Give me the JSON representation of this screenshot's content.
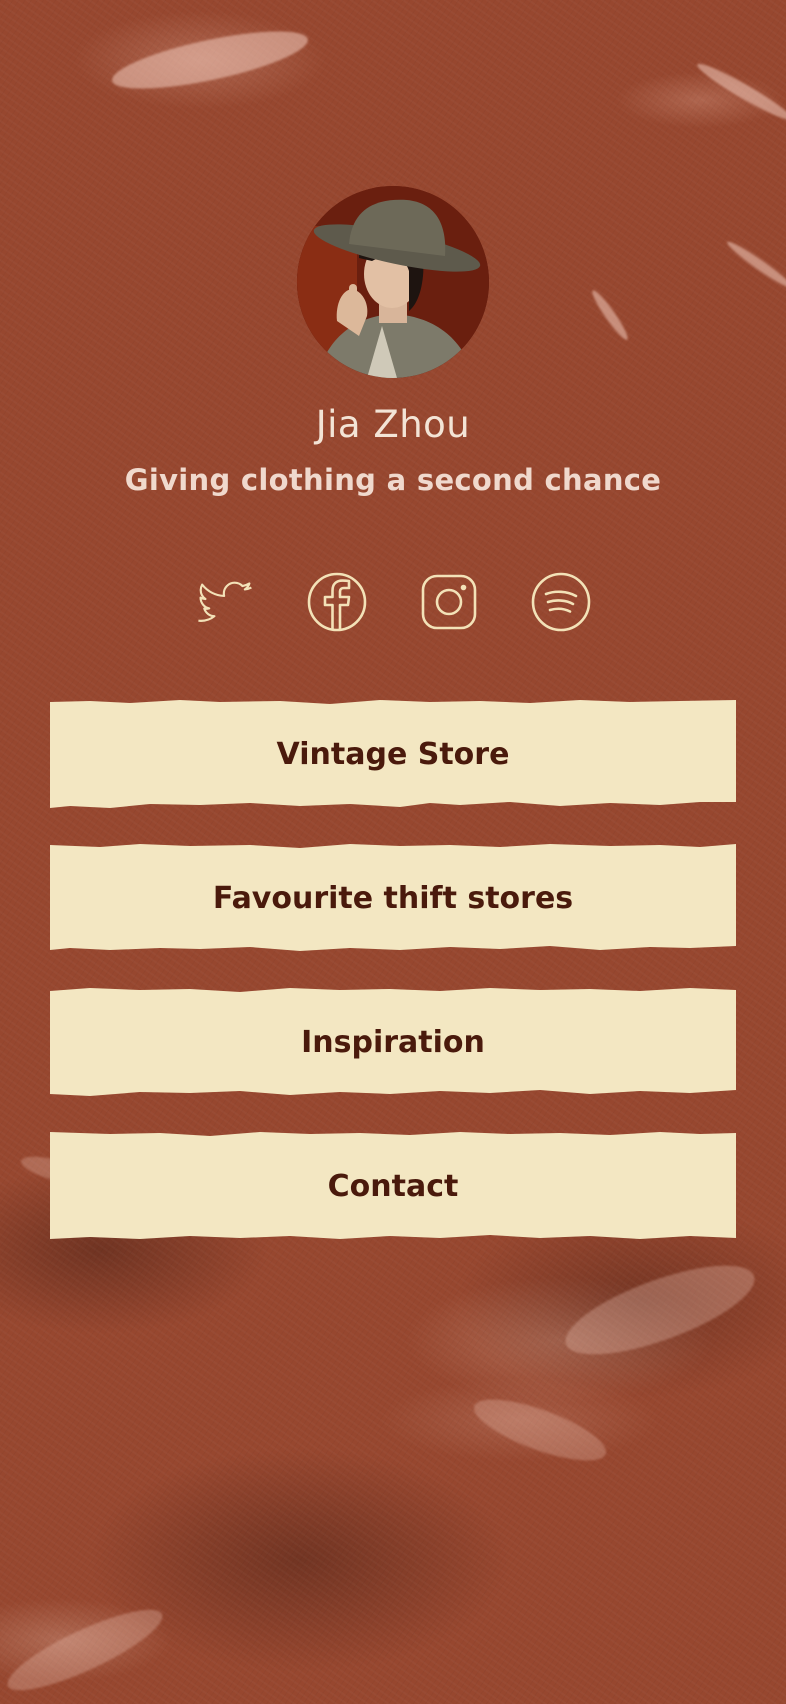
{
  "profile": {
    "name": "Jia Zhou",
    "tagline": "Giving clothing a second chance",
    "avatar": "portrait-photo"
  },
  "socials": [
    {
      "icon": "twitter-icon"
    },
    {
      "icon": "facebook-icon"
    },
    {
      "icon": "instagram-icon"
    },
    {
      "icon": "spotify-icon"
    }
  ],
  "links": [
    {
      "label": "Vintage Store"
    },
    {
      "label": "Favourite thift stores"
    },
    {
      "label": "Inspiration"
    },
    {
      "label": "Contact"
    }
  ],
  "colors": {
    "background": "#97472f",
    "button": "#f3e7c2",
    "button_text": "#4a1a0c",
    "icon_stroke": "#f3e2b8",
    "name_text": "#f3e4d6"
  }
}
